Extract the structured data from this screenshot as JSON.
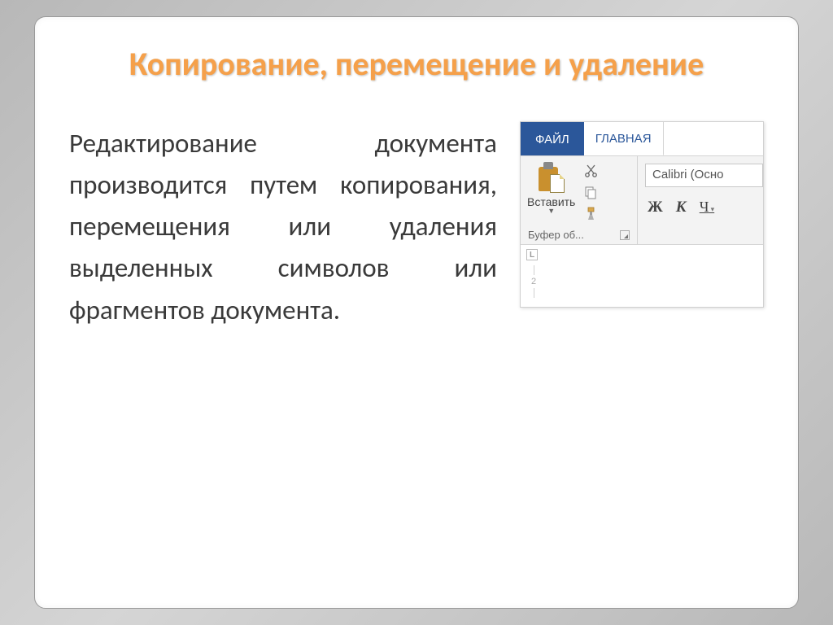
{
  "title": "Копирование, перемещение и удаление",
  "body": "Редактирование документа производится путем копирования, перемещения или удаления выделенных символов или фрагментов документа.",
  "ribbon": {
    "file_tab": "ФАЙЛ",
    "home_tab": "ГЛАВНАЯ",
    "paste_label": "Вставить",
    "clipboard_group": "Буфер об...",
    "font_name": "Calibri (Осно",
    "bold": "Ж",
    "italic": "К",
    "underline": "Ч",
    "corner_marker": "L",
    "ruler_num": "2"
  }
}
